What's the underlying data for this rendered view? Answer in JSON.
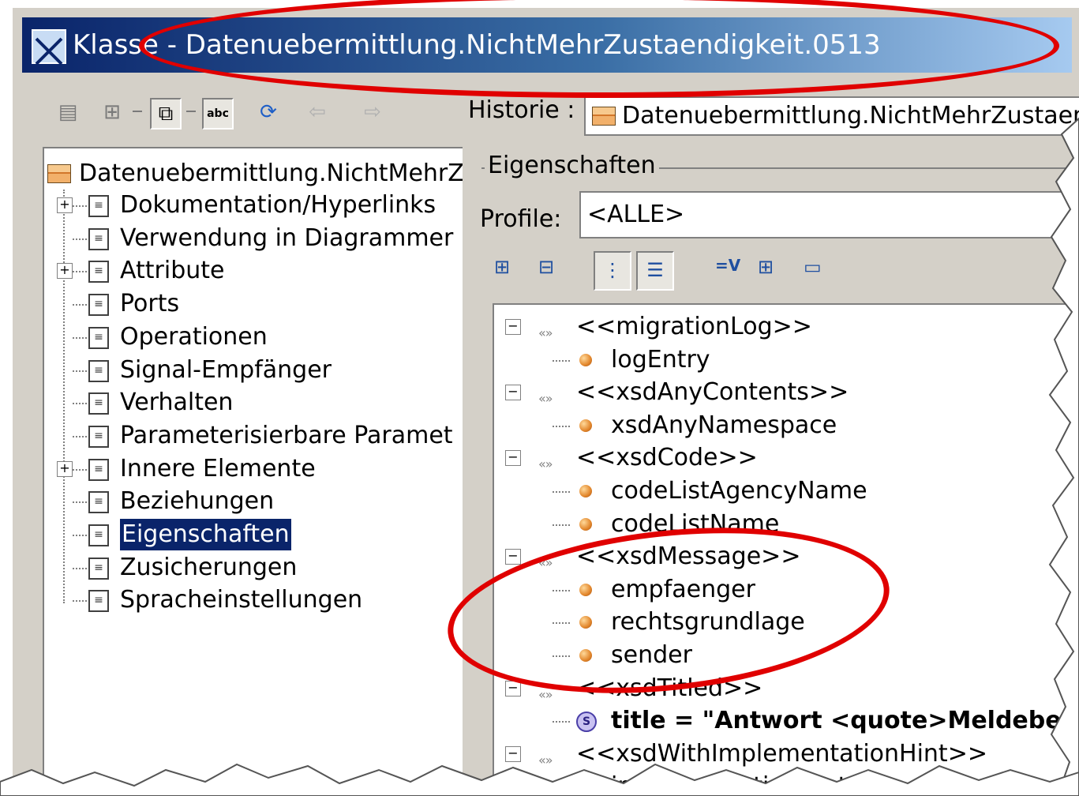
{
  "window": {
    "title": "Klasse - Datenuebermittlung.NichtMehrZustaendigkeit.0513"
  },
  "toolbar": {
    "icons": [
      "list-view-icon",
      "tree-view-icon",
      "window-icon",
      "spellcheck-icon",
      "refresh-icon",
      "back-arrow-icon",
      "forward-arrow-icon"
    ],
    "spellcheck_text": "abc",
    "history_label": "Historie :",
    "history_value": "Datenuebermittlung.NichtMehrZustaend."
  },
  "tree": {
    "root": "Datenuebermittlung.NichtMehrZ",
    "items": [
      {
        "label": "Dokumentation/Hyperlinks",
        "expandable": true
      },
      {
        "label": "Verwendung in Diagrammer",
        "expandable": false
      },
      {
        "label": "Attribute",
        "expandable": true
      },
      {
        "label": "Ports",
        "expandable": false
      },
      {
        "label": "Operationen",
        "expandable": false
      },
      {
        "label": "Signal-Empfänger",
        "expandable": false
      },
      {
        "label": "Verhalten",
        "expandable": false
      },
      {
        "label": "Parameterisierbare Paramet",
        "expandable": false
      },
      {
        "label": "Innere Elemente",
        "expandable": true
      },
      {
        "label": "Beziehungen",
        "expandable": false
      },
      {
        "label": "Eigenschaften",
        "expandable": false,
        "selected": true
      },
      {
        "label": "Zusicherungen",
        "expandable": false
      },
      {
        "label": "Spracheinstellungen",
        "expandable": false
      }
    ]
  },
  "properties": {
    "group_label": "Eigenschaften",
    "profile_label": "Profile:",
    "profile_value": "<ALLE>",
    "toolbar_icons": [
      "expand-all-icon",
      "collapse-all-icon",
      "show-inherited-icon",
      "tree-mode-icon",
      "equals-value-icon",
      "grid-icon",
      "field-icon"
    ],
    "equals_icon_text": "=V",
    "rows": [
      {
        "type": "stereotype",
        "label": "<<migrationLog>>"
      },
      {
        "type": "attribute",
        "label": "logEntry"
      },
      {
        "type": "stereotype",
        "label": "<<xsdAnyContents>>"
      },
      {
        "type": "attribute",
        "label": "xsdAnyNamespace"
      },
      {
        "type": "stereotype",
        "label": "<<xsdCode>>"
      },
      {
        "type": "attribute",
        "label": "codeListAgencyName"
      },
      {
        "type": "attribute",
        "label": "codeListName"
      },
      {
        "type": "stereotype",
        "label": "<<xsdMessage>>"
      },
      {
        "type": "attribute",
        "label": "empfaenger"
      },
      {
        "type": "attribute",
        "label": "rechtsgrundlage"
      },
      {
        "type": "attribute",
        "label": "sender"
      },
      {
        "type": "stereotype",
        "label": "<<xsdTitled>>"
      },
      {
        "type": "value",
        "label": "title = \"Antwort <quote>Meldebeh"
      },
      {
        "type": "stereotype",
        "label": "<<xsdWithImplementationHint>>"
      },
      {
        "type": "attribute",
        "label": "implementationHint"
      }
    ]
  },
  "annotations": {
    "color": "#e00000"
  }
}
